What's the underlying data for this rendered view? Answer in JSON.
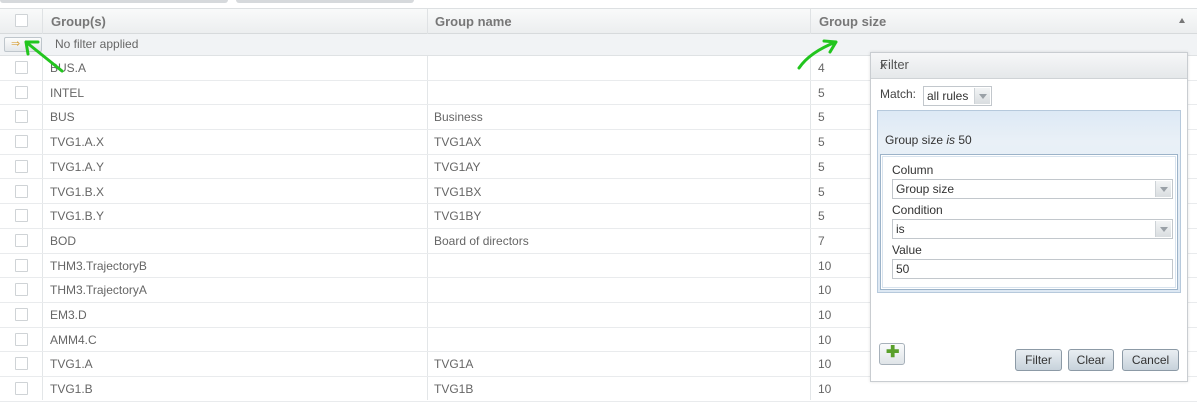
{
  "table": {
    "columns": [
      "Group(s)",
      "Group name",
      "Group size"
    ],
    "filter_status": "No filter applied",
    "rows": [
      {
        "group": "BUS.A",
        "name": "",
        "size": "4"
      },
      {
        "group": "INTEL",
        "name": "",
        "size": "5"
      },
      {
        "group": "BUS",
        "name": "Business",
        "size": "5"
      },
      {
        "group": "TVG1.A.X",
        "name": "TVG1AX",
        "size": "5"
      },
      {
        "group": "TVG1.A.Y",
        "name": "TVG1AY",
        "size": "5"
      },
      {
        "group": "TVG1.B.X",
        "name": "TVG1BX",
        "size": "5"
      },
      {
        "group": "TVG1.B.Y",
        "name": "TVG1BY",
        "size": "5"
      },
      {
        "group": "BOD",
        "name": "Board of directors",
        "size": "7"
      },
      {
        "group": "THM3.TrajectoryB",
        "name": "",
        "size": "10"
      },
      {
        "group": "THM3.TrajectoryA",
        "name": "",
        "size": "10"
      },
      {
        "group": "EM3.D",
        "name": "",
        "size": "10"
      },
      {
        "group": "AMM4.C",
        "name": "",
        "size": "10"
      },
      {
        "group": "TVG1.A",
        "name": "TVG1A",
        "size": "10"
      },
      {
        "group": "TVG1.B",
        "name": "TVG1B",
        "size": "10"
      }
    ]
  },
  "filter_dialog": {
    "title": "Filter",
    "close": "x",
    "match_label": "Match:",
    "match_value": "all rules",
    "rule_summary_prefix": "Group size ",
    "rule_summary_op": "is",
    "rule_summary_value": " 50",
    "column_label": "Column",
    "column_value": "Group size",
    "condition_label": "Condition",
    "condition_value": "is",
    "value_label": "Value",
    "value_value": "50",
    "buttons": {
      "filter": "Filter",
      "clear": "Clear",
      "cancel": "Cancel"
    }
  },
  "icons": {
    "sort": "sort-ascending-icon",
    "filter_toggle": "filter-arrow-icon",
    "add_rule": "plus-icon"
  },
  "colors": {
    "annotation_arrow": "#22c51e",
    "add_icon": "#5aa02c",
    "panel_border": "#b6c9dc"
  }
}
